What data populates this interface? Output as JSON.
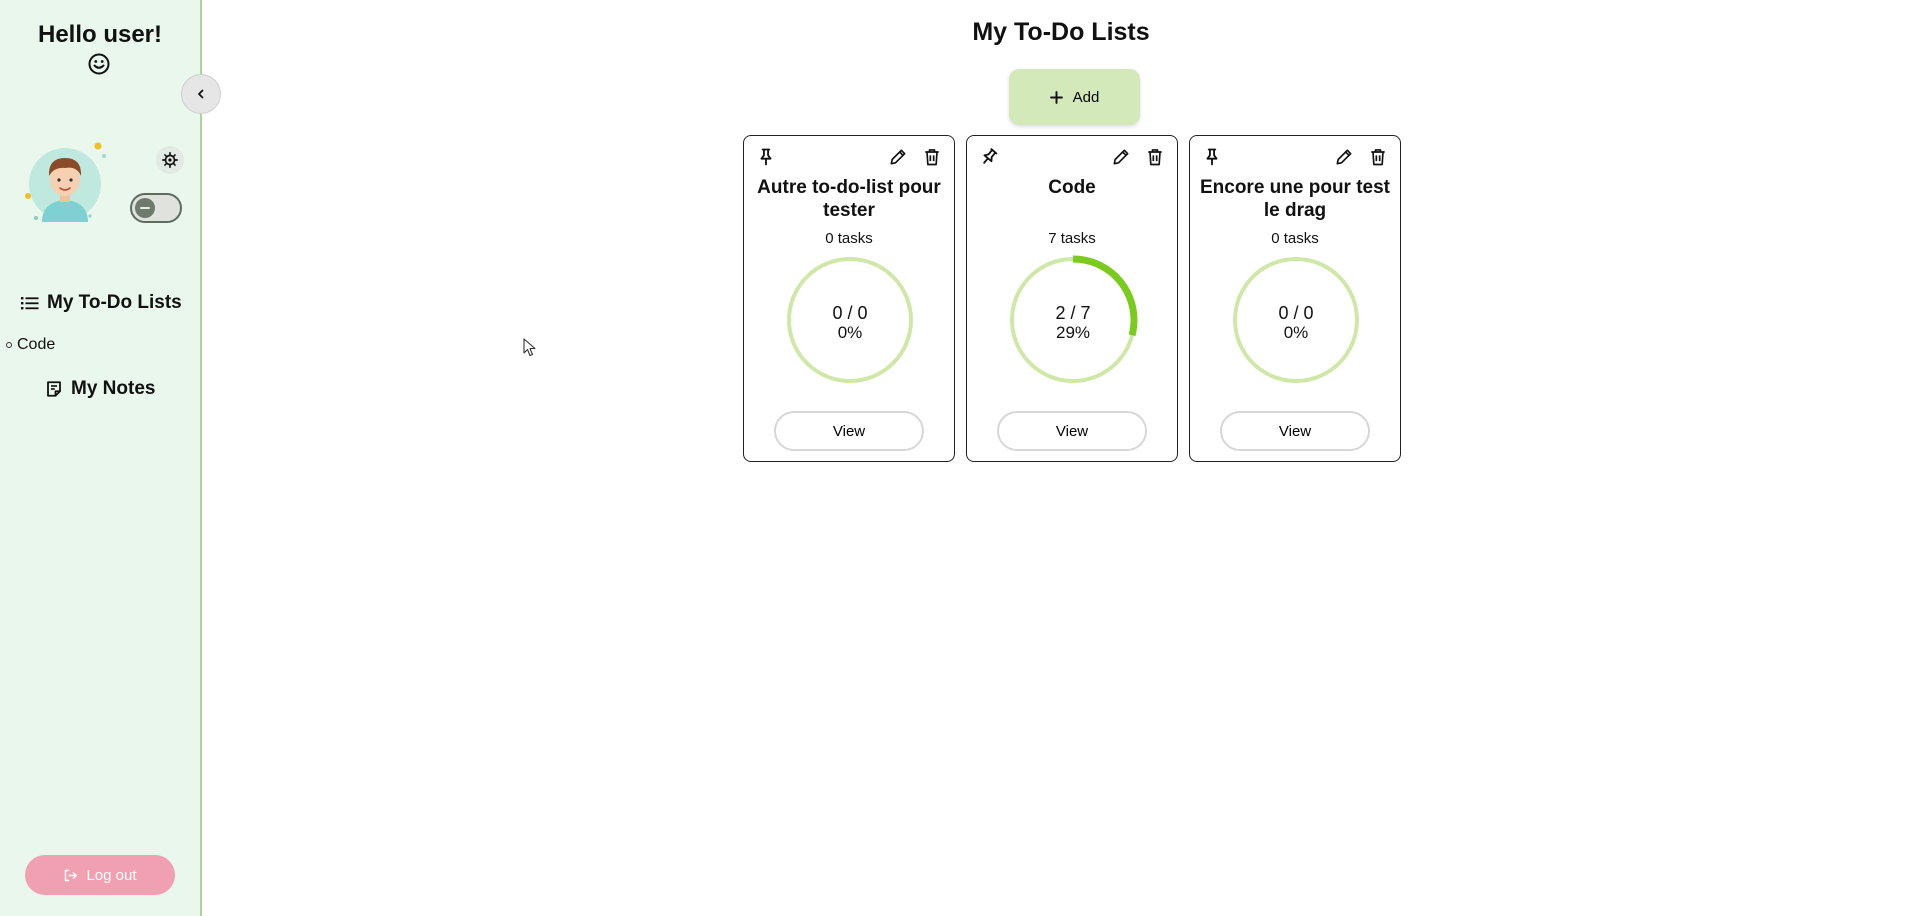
{
  "sidebar": {
    "greeting": "Hello user!",
    "smiley_icon": "smiley-face-icon",
    "nav": {
      "lists_label": "My To-Do Lists",
      "items": [
        {
          "label": "Code"
        }
      ],
      "notes_label": "My Notes"
    },
    "logout_label": "Log out"
  },
  "main": {
    "title": "My To-Do Lists",
    "add_label": "Add",
    "cards": [
      {
        "title": "Autre to-do-list pour tester",
        "count": "0 tasks",
        "progress_label": "0 / 0",
        "percent_label": "0%",
        "progress": 0,
        "view_label": "View"
      },
      {
        "title": "Code",
        "count": "7 tasks",
        "progress_label": "2 / 7",
        "percent_label": "29%",
        "progress": 0.29,
        "view_label": "View"
      },
      {
        "title": "Encore une pour test le drag",
        "count": "0 tasks",
        "progress_label": "0 / 0",
        "percent_label": "0%",
        "progress": 0,
        "view_label": "View"
      }
    ]
  },
  "colors": {
    "sidebar_bg": "#e9f7ec",
    "sidebar_border": "#a8d59a",
    "add_button": "#d3e9b9",
    "logout_button": "#f0a0b0",
    "progress_track": "#cfe8a8",
    "progress_fill": "#7acb1e"
  }
}
